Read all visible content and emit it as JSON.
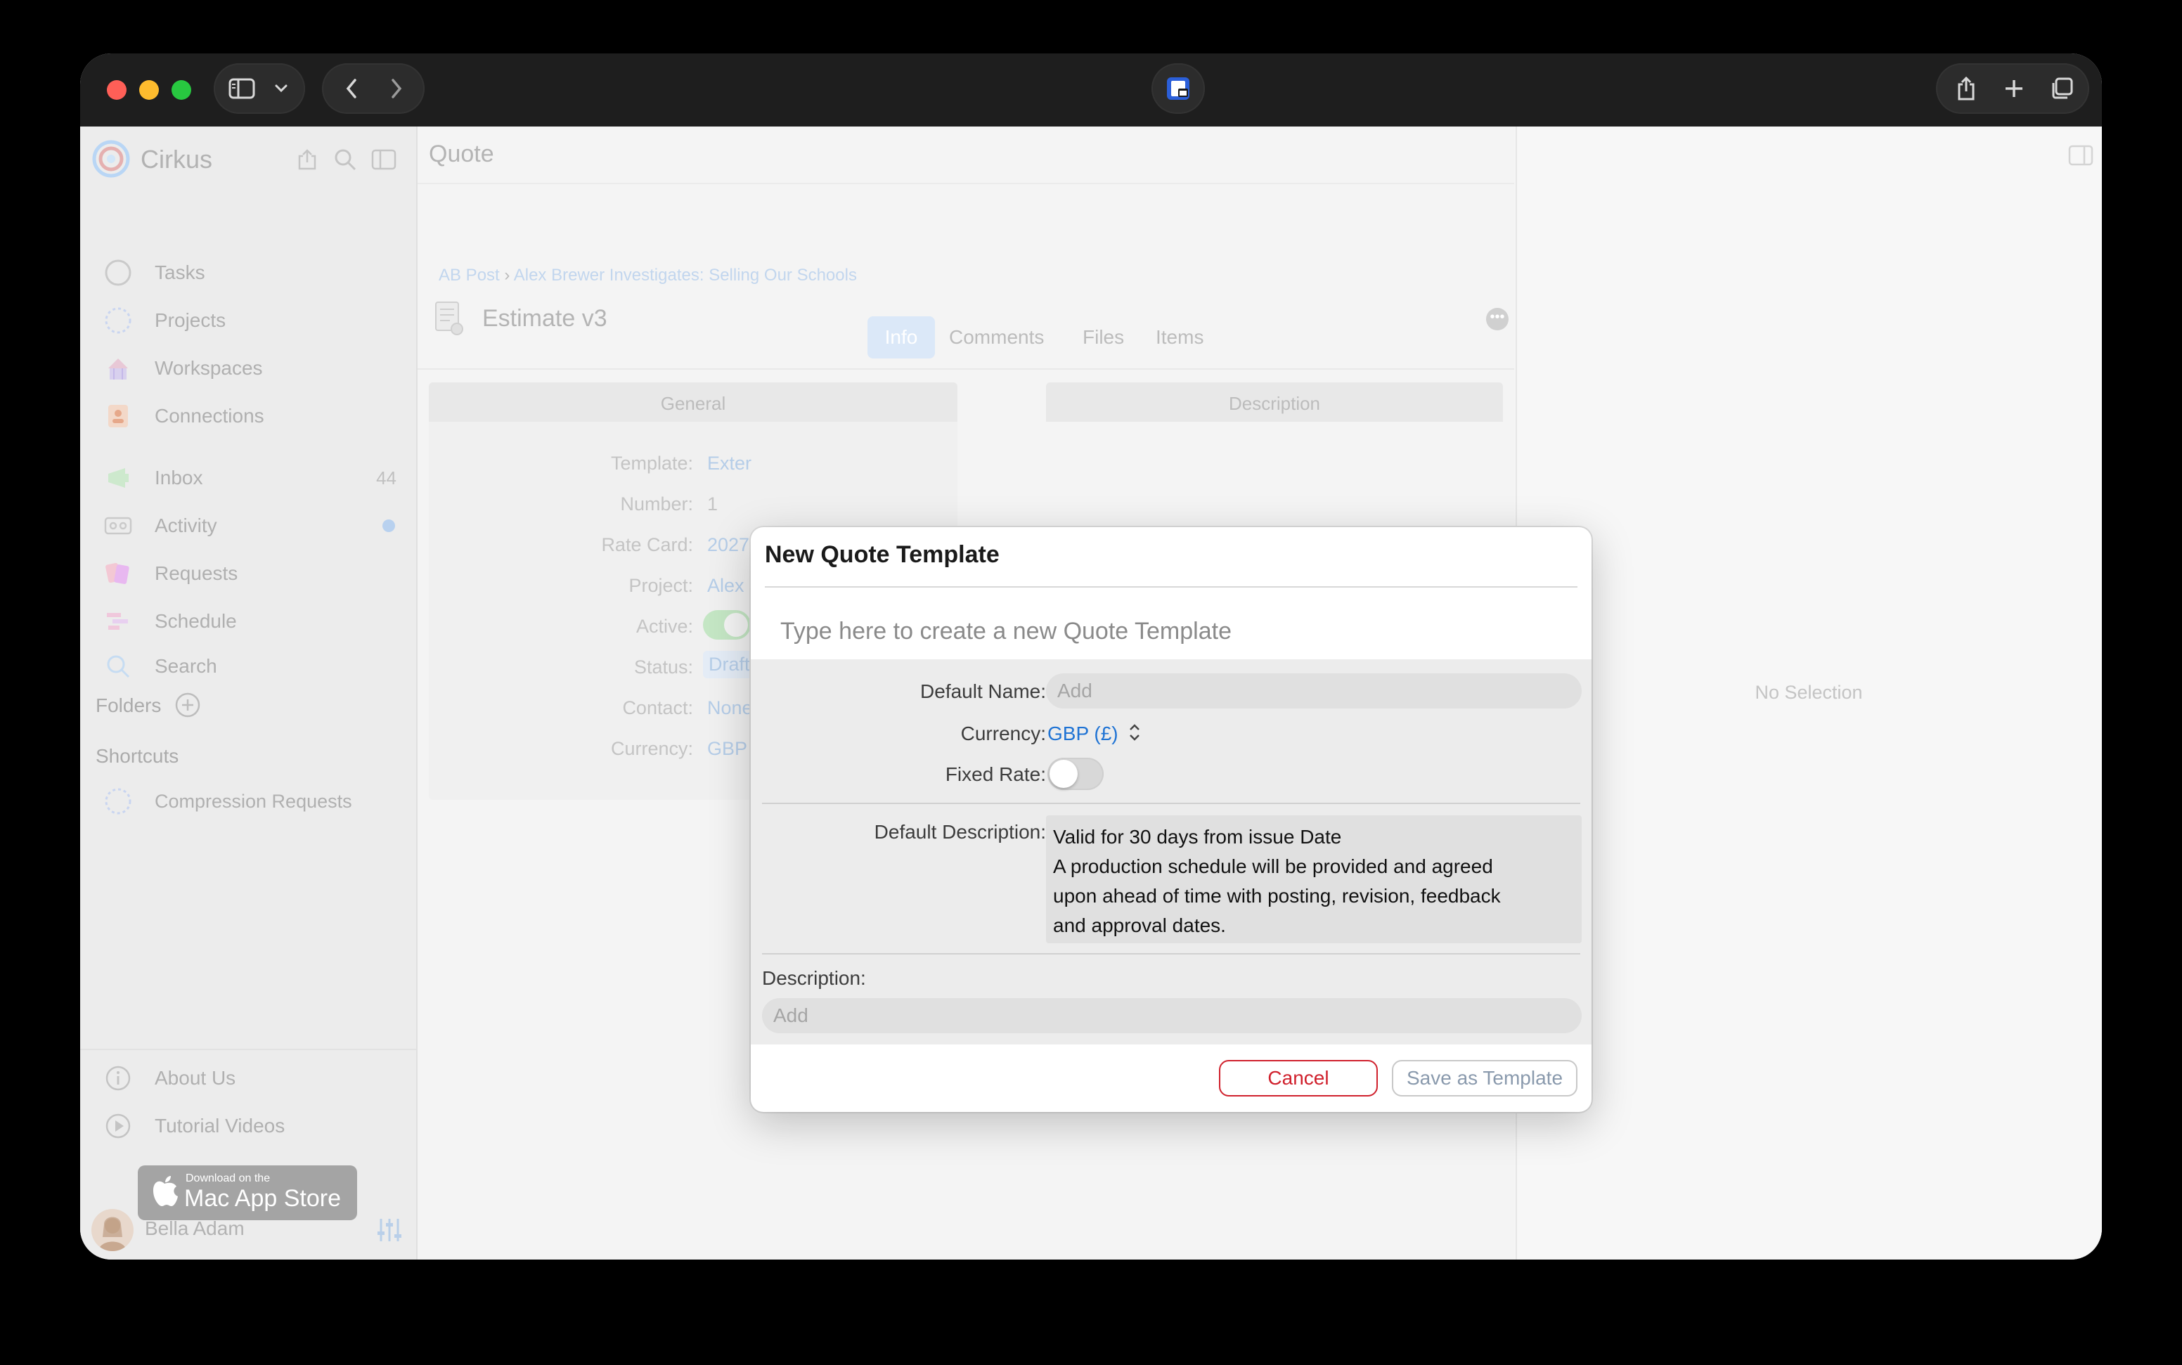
{
  "app": {
    "name": "Cirkus"
  },
  "sidebar": {
    "items": [
      {
        "label": "Tasks",
        "icon": "circle-icon"
      },
      {
        "label": "Projects",
        "icon": "dotted-circle-icon"
      },
      {
        "label": "Workspaces",
        "icon": "workspaces-icon"
      },
      {
        "label": "Connections",
        "icon": "connections-icon"
      },
      {
        "label": "Inbox",
        "icon": "inbox-icon",
        "badge": "44"
      },
      {
        "label": "Activity",
        "icon": "activity-icon"
      },
      {
        "label": "Requests",
        "icon": "requests-icon"
      },
      {
        "label": "Schedule",
        "icon": "schedule-icon"
      },
      {
        "label": "Search",
        "icon": "search-icon"
      }
    ],
    "folders_label": "Folders",
    "shortcuts_label": "Shortcuts",
    "shortcuts": [
      {
        "label": "Compression Requests"
      }
    ],
    "footer_items": [
      {
        "label": "About Us",
        "icon": "info-icon"
      },
      {
        "label": "Tutorial Videos",
        "icon": "play-icon"
      }
    ],
    "appstore": {
      "small": "Download on the",
      "big": "Mac App Store"
    },
    "user": {
      "name": "Bella Adam"
    }
  },
  "main": {
    "header_title": "Quote",
    "breadcrumb": [
      "AB Post",
      "Alex Brewer Investigates: Selling Our Schools"
    ],
    "breadcrumb_sep": "›",
    "doc_title": "Estimate v3",
    "tabs": [
      "Info",
      "Comments",
      "Files",
      "Items"
    ],
    "section_general": "General",
    "section_description": "Description",
    "fields": [
      {
        "label": "Template:",
        "value": "Exter"
      },
      {
        "label": "Number:",
        "value": "1"
      },
      {
        "label": "Rate Card:",
        "value": "2027"
      },
      {
        "label": "Project:",
        "value": "Alex I"
      },
      {
        "label": "Active:",
        "value": ""
      },
      {
        "label": "Status:",
        "value": "Draft"
      },
      {
        "label": "Contact:",
        "value": "None"
      },
      {
        "label": "Currency:",
        "value": "GBP"
      }
    ]
  },
  "right_panel": {
    "empty_text": "No Selection"
  },
  "dialog": {
    "title": "New Quote Template",
    "name_placeholder": "Type here to create a new Quote Template",
    "default_name_label": "Default Name:",
    "default_name_placeholder": "Add",
    "currency_label": "Currency:",
    "currency_value": "GBP (£)",
    "fixed_rate_label": "Fixed Rate:",
    "fixed_rate_on": false,
    "default_description_label": "Default Description:",
    "default_description_lines": [
      "Valid for 30 days from issue Date",
      "A production schedule will be provided and agreed",
      "upon ahead of time with posting, revision, feedback",
      "and approval dates."
    ],
    "description_label": "Description:",
    "description_placeholder": "Add",
    "cancel_label": "Cancel",
    "save_label": "Save as Template"
  },
  "colors": {
    "accent_blue": "#1f73d4",
    "cancel_red": "#d0202c",
    "traffic_red": "#ff5f57",
    "traffic_yellow": "#febc2e",
    "traffic_green": "#28c840"
  }
}
